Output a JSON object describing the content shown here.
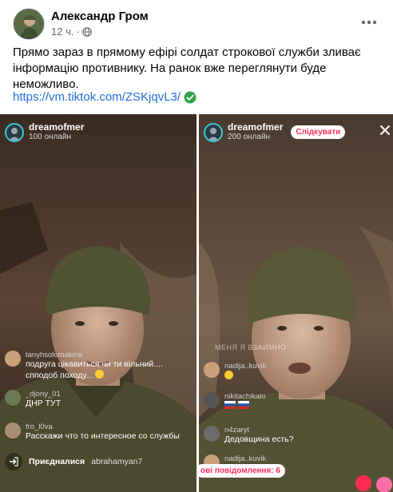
{
  "post": {
    "author": "Александр Гром",
    "time": "12 ч.",
    "separator": "·",
    "more_icon": "more-horizontal-icon",
    "text": "Прямо зараз в прямому ефірі солдат строкової служби зливає інформацію противнику. На ранок вже переглянути буде неможливо.",
    "link": "https://vm.tiktok.com/ZSKjqvL3/"
  },
  "left_stream": {
    "username": "dreamofmer",
    "viewers": "100 онлайн",
    "comments": [
      {
        "name": "tanyhsolomakina",
        "text": "подруга цікавиться чи ти вільний.... спподоб походу...",
        "color": "#c9a27a"
      },
      {
        "name": "_djony_01",
        "text": "ДНР ТУТ",
        "color": "#6b7a55"
      },
      {
        "name": "fro_l0va",
        "text": "Расскажи что то интересное со службы",
        "color": "#a88f74"
      }
    ],
    "joined_label": "Приєдналися",
    "joined_user": "abrahamyan7"
  },
  "right_stream": {
    "username": "dreamofmer",
    "viewers": "200 онлайн",
    "follow_label": "Слідкувати",
    "overlay_text": "МЕНЯ Я ВЗАИМНО",
    "comments": [
      {
        "name": "nadija..kuvik",
        "text": "",
        "color": "#c8a07c"
      },
      {
        "name": "nikitachikalo",
        "text": "",
        "color": "#555555"
      },
      {
        "name": "n4zaryt",
        "text": "Дедовщина есть?",
        "color": "#6c6c6c"
      },
      {
        "name": "nadija..kuvik",
        "text": "",
        "color": "#c8a07c"
      }
    ],
    "new_messages": "ові повідомлення: 6"
  },
  "colors": {
    "link": "#216fdb",
    "verified": "#31a24c",
    "tiktok_red": "#fe2c55",
    "meta_gray": "#65676b"
  }
}
